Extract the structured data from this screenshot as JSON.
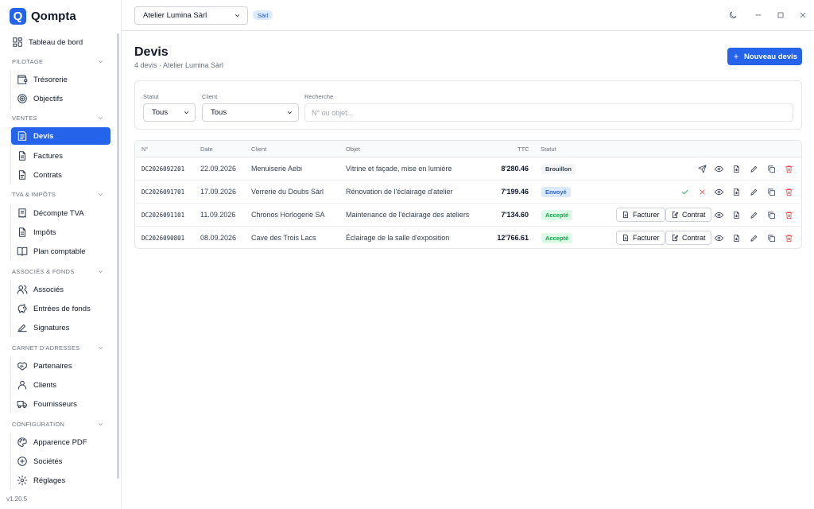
{
  "app": {
    "logo_letter": "Q",
    "name": "Qompta",
    "version": "v1.20.5"
  },
  "sidebar": {
    "top_item": {
      "label": "Tableau de bord",
      "icon": "dashboard-icon"
    },
    "sections": [
      {
        "title": "Pilotage",
        "items": [
          {
            "label": "Trésorerie",
            "icon": "wallet-icon"
          },
          {
            "label": "Objectifs",
            "icon": "target-icon"
          }
        ]
      },
      {
        "title": "Ventes",
        "items": [
          {
            "label": "Devis",
            "icon": "quote-icon",
            "active": true
          },
          {
            "label": "Factures",
            "icon": "invoice-icon"
          },
          {
            "label": "Contrats",
            "icon": "contract-icon"
          }
        ]
      },
      {
        "title": "TVA & Impôts",
        "items": [
          {
            "label": "Décompte TVA",
            "icon": "receipt-icon"
          },
          {
            "label": "Impôts",
            "icon": "tax-icon"
          },
          {
            "label": "Plan comptable",
            "icon": "book-icon"
          }
        ]
      },
      {
        "title": "Associés & fonds",
        "items": [
          {
            "label": "Associés",
            "icon": "users-icon"
          },
          {
            "label": "Entrées de fonds",
            "icon": "piggy-bank-icon"
          },
          {
            "label": "Signatures",
            "icon": "signature-icon"
          }
        ]
      },
      {
        "title": "Carnet d'adresses",
        "items": [
          {
            "label": "Partenaires",
            "icon": "handshake-icon"
          },
          {
            "label": "Clients",
            "icon": "user-icon"
          },
          {
            "label": "Fournisseurs",
            "icon": "truck-icon"
          }
        ]
      },
      {
        "title": "Configuration",
        "items": [
          {
            "label": "Apparence PDF",
            "icon": "palette-icon"
          },
          {
            "label": "Sociétés",
            "icon": "building-icon"
          },
          {
            "label": "Réglages",
            "icon": "settings-icon"
          }
        ]
      }
    ]
  },
  "topbar": {
    "company": "Atelier Lumina Sàrl",
    "company_type": "Sàrl"
  },
  "page": {
    "title": "Devis",
    "subtitle": "4 devis · Atelier Lumina Sàrl",
    "new_button": "Nouveau devis"
  },
  "filters": {
    "status_label": "Statut",
    "status_value": "Tous",
    "client_label": "Client",
    "client_value": "Tous",
    "search_label": "Recherche",
    "search_placeholder": "N° ou objet..."
  },
  "table": {
    "headers": {
      "num": "N°",
      "date": "Date",
      "client": "Client",
      "object": "Objet",
      "ttc": "TTC",
      "status": "Statut"
    },
    "invoice_label": "Facturer",
    "contract_label": "Contrat",
    "rows": [
      {
        "num": "DC2026092201",
        "date": "22.09.2026",
        "client": "Menuiserie Aebi",
        "object": "Vitrine et façade, mise en lumière",
        "ttc": "8'280.46",
        "status": "Brouillon",
        "status_kind": "draft"
      },
      {
        "num": "DC2026091701",
        "date": "17.09.2026",
        "client": "Verrerie du Doubs Sàrl",
        "object": "Rénovation de l'éclairage d'atelier",
        "ttc": "7'199.46",
        "status": "Envoyé",
        "status_kind": "sent"
      },
      {
        "num": "DC2026091101",
        "date": "11.09.2026",
        "client": "Chronos Horlogerie SA",
        "object": "Maintenance de l'éclairage des ateliers",
        "ttc": "7'134.60",
        "status": "Accepté",
        "status_kind": "accepted"
      },
      {
        "num": "DC2026090801",
        "date": "08.09.2026",
        "client": "Cave des Trois Lacs",
        "object": "Éclairage de la salle d'exposition",
        "ttc": "12'766.61",
        "status": "Accepté",
        "status_kind": "accepted"
      }
    ]
  },
  "colors": {
    "accent": "#2563eb",
    "danger": "#ef4444",
    "success": "#16a34a"
  }
}
